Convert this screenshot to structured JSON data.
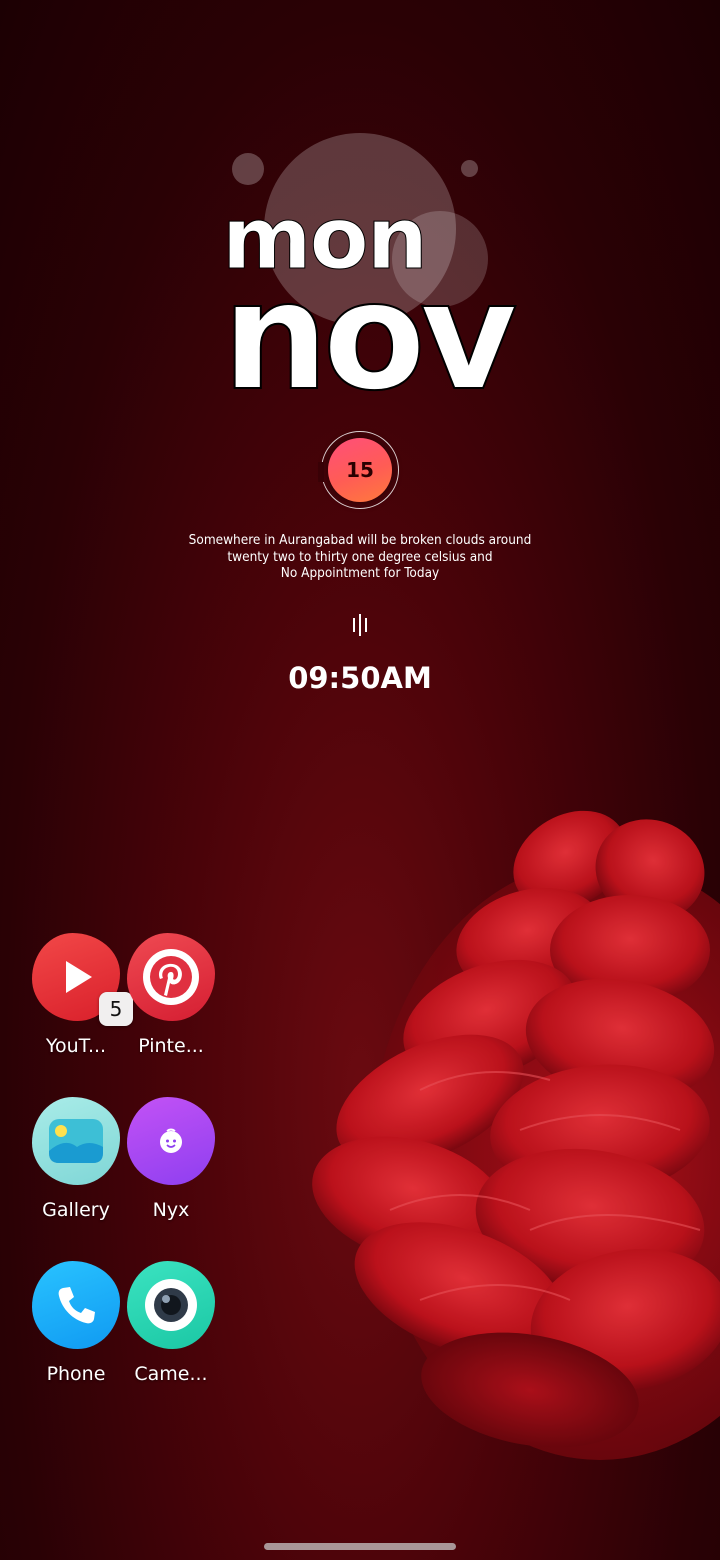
{
  "widget": {
    "day": "mon",
    "month": "nov",
    "date": "15",
    "summary_lines": [
      "Somewhere in Aurangabad will be broken clouds around",
      "twenty two to thirty one degree celsius and",
      "No Appointment for Today"
    ],
    "time": "09:50AM"
  },
  "apps": [
    {
      "label": "YouT...",
      "icon": "youtube-icon",
      "badge": "5"
    },
    {
      "label": "Pinte...",
      "icon": "pinterest-icon"
    },
    {
      "label": "Gallery",
      "icon": "gallery-icon"
    },
    {
      "label": "Nyx",
      "icon": "nyx-icon"
    },
    {
      "label": "Phone",
      "icon": "phone-icon"
    },
    {
      "label": "Came...",
      "icon": "camera-icon"
    }
  ],
  "colors": {
    "background": "#4a0309",
    "date_circle": "#ff5c55",
    "youtube": "#e63238",
    "pinterest": "#e53642",
    "nyx": "#a948f3",
    "phone": "#1aaff8",
    "camera": "#27d6b3"
  }
}
